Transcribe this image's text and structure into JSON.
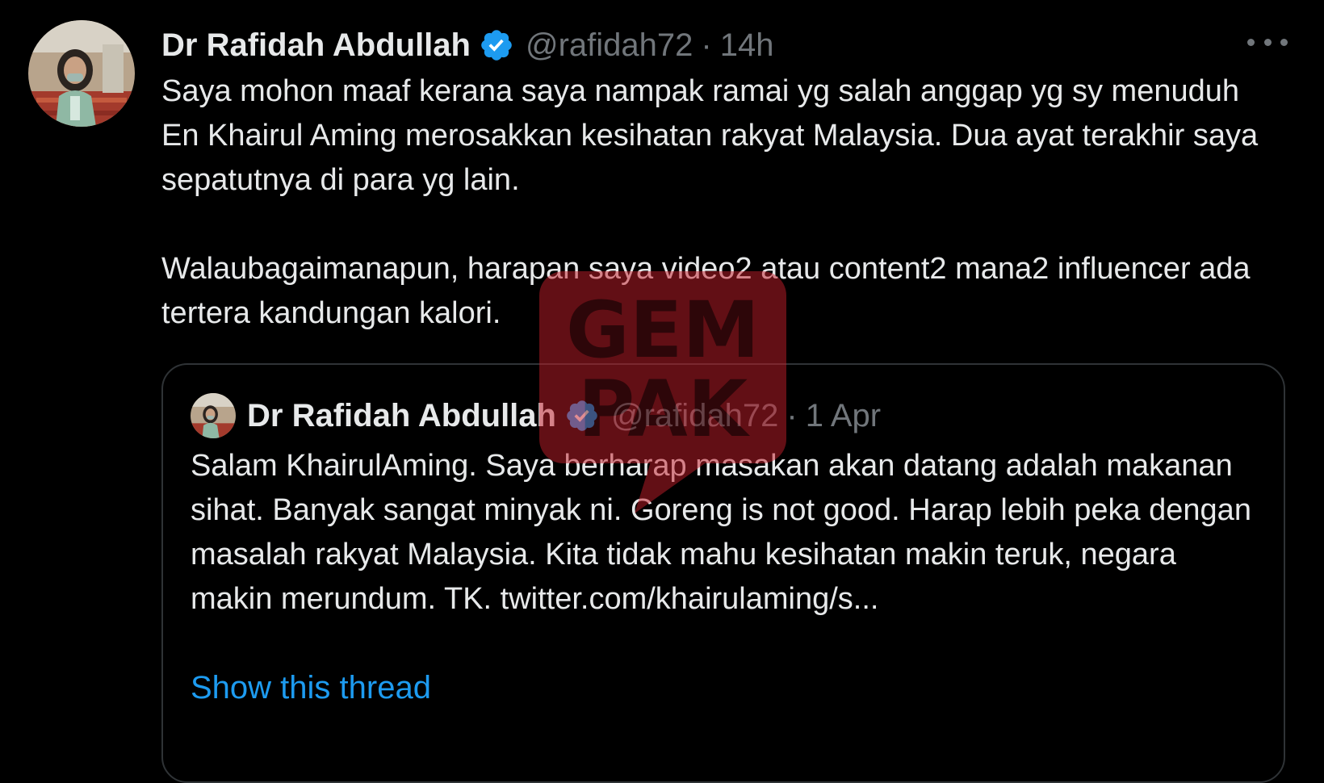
{
  "tweet": {
    "author": {
      "display_name": "Dr Rafidah Abdullah",
      "handle": "@rafidah72",
      "verified": true
    },
    "separator": "·",
    "time": "14h",
    "paragraphs": [
      "Saya mohon maaf kerana saya nampak ramai yg salah anggap yg sy menuduh En Khairul Aming merosakkan kesihatan rakyat Malaysia. Dua ayat terakhir saya sepatutnya di para yg lain.",
      "Walaubagaimanapun, harapan saya video2 atau content2 mana2 influencer ada tertera kandungan kalori."
    ],
    "more_icon": "more-dots-icon"
  },
  "quoted_tweet": {
    "author": {
      "display_name": "Dr Rafidah Abdullah",
      "handle": "@rafidah72",
      "verified": true
    },
    "separator": "·",
    "time": "1 Apr",
    "text": "Salam KhairulAming. Saya berharap masakan akan datang adalah makanan sihat. Banyak sangat minyak ni. Goreng is not good. Harap lebih peka dengan masalah rakyat Malaysia. Kita tidak mahu kesihatan makin teruk, negara makin merundum. TK. twitter.com/khairulaming/s...",
    "show_thread_label": "Show this thread"
  },
  "watermark": {
    "line1": "GEM",
    "line2": "PAK"
  },
  "colors": {
    "background": "#000000",
    "text_primary": "#e7e9ea",
    "text_secondary": "#71767b",
    "link": "#1d9bf0",
    "border": "#2f3336",
    "verified_badge": "#1d9bf0",
    "watermark": "#c41e2a"
  }
}
